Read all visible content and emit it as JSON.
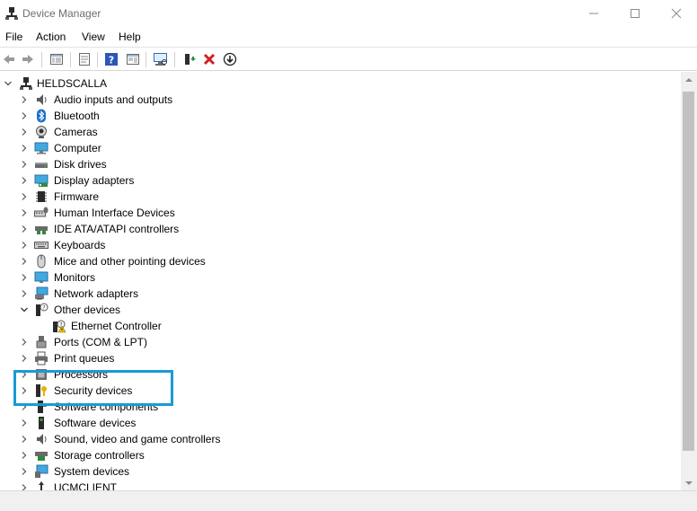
{
  "window": {
    "title": "Device Manager"
  },
  "menu": [
    "File",
    "Action",
    "View",
    "Help"
  ],
  "toolbar": {
    "icons": [
      "back-arrow-icon",
      "forward-arrow-icon",
      "show-hide-console-tree-icon",
      "properties-icon",
      "help-icon",
      "action-pane-icon",
      "scan-hardware-icon",
      "update-driver-icon",
      "uninstall-device-icon",
      "disable-device-icon"
    ]
  },
  "tree": {
    "root": "HELDSCALLA",
    "categories": [
      {
        "label": "Audio inputs and outputs",
        "icon": "speaker-icon",
        "expanded": false
      },
      {
        "label": "Bluetooth",
        "icon": "bluetooth-icon",
        "expanded": false
      },
      {
        "label": "Cameras",
        "icon": "camera-icon",
        "expanded": false
      },
      {
        "label": "Computer",
        "icon": "computer-icon",
        "expanded": false
      },
      {
        "label": "Disk drives",
        "icon": "disk-drive-icon",
        "expanded": false
      },
      {
        "label": "Display adapters",
        "icon": "display-adapter-icon",
        "expanded": false
      },
      {
        "label": "Firmware",
        "icon": "firmware-chip-icon",
        "expanded": false
      },
      {
        "label": "Human Interface Devices",
        "icon": "hid-icon",
        "expanded": false
      },
      {
        "label": "IDE ATA/ATAPI controllers",
        "icon": "ide-controller-icon",
        "expanded": false
      },
      {
        "label": "Keyboards",
        "icon": "keyboard-icon",
        "expanded": false
      },
      {
        "label": "Mice and other pointing devices",
        "icon": "mouse-icon",
        "expanded": false
      },
      {
        "label": "Monitors",
        "icon": "monitor-icon",
        "expanded": false
      },
      {
        "label": "Network adapters",
        "icon": "network-adapter-icon",
        "expanded": false
      },
      {
        "label": "Other devices",
        "icon": "unknown-device-icon",
        "expanded": true,
        "children": [
          {
            "label": "Ethernet Controller",
            "icon": "warning-device-icon"
          }
        ]
      },
      {
        "label": "Ports (COM & LPT)",
        "icon": "port-icon",
        "expanded": false
      },
      {
        "label": "Print queues",
        "icon": "printer-icon",
        "expanded": false
      },
      {
        "label": "Processors",
        "icon": "processor-icon",
        "expanded": false
      },
      {
        "label": "Security devices",
        "icon": "security-key-icon",
        "expanded": false
      },
      {
        "label": "Software components",
        "icon": "software-component-icon",
        "expanded": false
      },
      {
        "label": "Software devices",
        "icon": "software-device-icon",
        "expanded": false
      },
      {
        "label": "Sound, video and game controllers",
        "icon": "sound-controller-icon",
        "expanded": false
      },
      {
        "label": "Storage controllers",
        "icon": "storage-controller-icon",
        "expanded": false
      },
      {
        "label": "System devices",
        "icon": "system-devices-icon",
        "expanded": false
      },
      {
        "label": "UCMCLIENT",
        "icon": "usb-connector-icon",
        "expanded": false
      }
    ]
  },
  "colors": {
    "highlight_border": "#1a9ad6",
    "uninstall_red": "#d11f1f",
    "scan_green": "#1f8f3a"
  }
}
